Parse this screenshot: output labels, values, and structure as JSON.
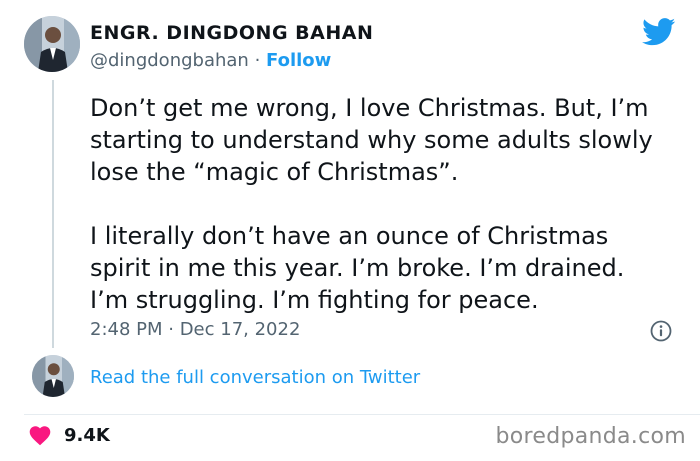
{
  "author": {
    "name": "ENGR. DINGDONG BAHAN",
    "handle": "@dingdongbahan",
    "separator": " · ",
    "follow_label": "Follow"
  },
  "tweet": {
    "paragraphs": [
      "Don’t get me wrong, I love Christmas. But, I’m starting to understand why some adults slowly lose the “magic of Christmas”.",
      "I literally don’t have an ounce of Christmas spirit in me this year. I’m broke. I’m drained. I’m struggling. I’m fighting for peace."
    ],
    "timestamp": "2:48 PM · Dec 17, 2022"
  },
  "conversation_link": "Read the full conversation on Twitter",
  "engagement": {
    "like_count": "9.4K"
  },
  "watermark": "boredpanda.com",
  "colors": {
    "accent": "#1d9bf0",
    "like": "#f91880",
    "text": "#0f1419",
    "secondary": "#536471"
  },
  "icons": {
    "brand": "twitter-bird-icon",
    "info": "info-icon",
    "like": "heart-icon"
  }
}
